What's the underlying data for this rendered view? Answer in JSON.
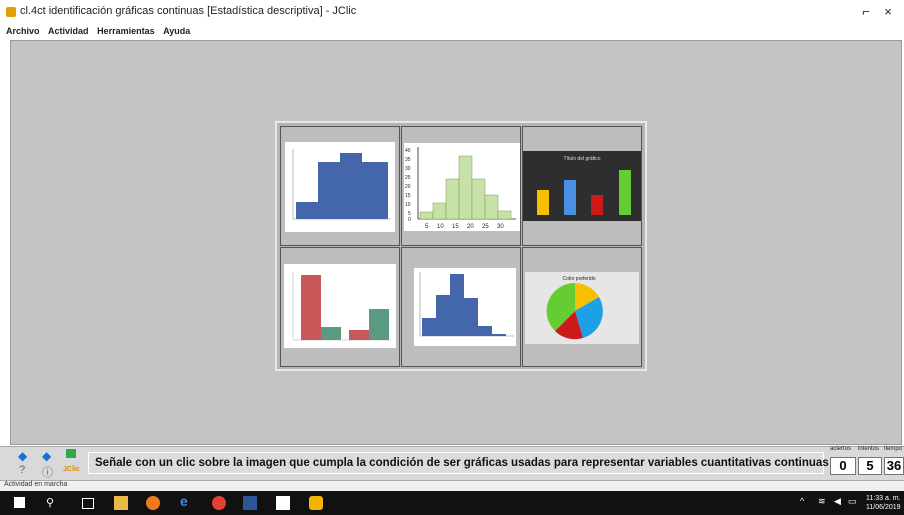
{
  "window": {
    "title": "cl.4ct identificación gráficas continuas [Estadística descriptiva] - JClic",
    "minimize_glyph": "⌐",
    "close_glyph": "×"
  },
  "menu": [
    "Archivo",
    "Actividad",
    "Herramientas",
    "Ayuda"
  ],
  "board": {
    "cells": [
      {
        "name": "histogram-blue",
        "kind": "image"
      },
      {
        "name": "histogram-green",
        "kind": "image"
      },
      {
        "name": "bar-chart-dark",
        "kind": "image"
      },
      {
        "name": "bar-chart-red-green",
        "kind": "image"
      },
      {
        "name": "histogram-blue-2",
        "kind": "image"
      },
      {
        "name": "pie-chart",
        "kind": "image"
      }
    ],
    "green_hist_yticks": [
      "40",
      "35",
      "30",
      "25",
      "20",
      "15",
      "10",
      "5",
      "0"
    ],
    "green_hist_xticks": [
      "5",
      "10",
      "15",
      "20",
      "25",
      "30"
    ],
    "dark_chart_title": "Título del gráfico",
    "pie_title": "Color preferido"
  },
  "controls": {
    "help_glyph": "?",
    "info_glyph": "ⓘ",
    "logo_text": "JClic"
  },
  "message": "Señale con un clic sobre la imagen que cumpla la  condición de ser gráficas usadas para representar variables cuantitativas continuas",
  "counters": {
    "labels": [
      "aciertos",
      "intentos",
      "tiempo"
    ],
    "values": [
      "0",
      "5",
      "36"
    ]
  },
  "status": "Actividad en marcha",
  "clock": {
    "time": "11:33 a. m.",
    "date": "11/06/2019"
  },
  "colors": {
    "workspace": "#c4c4c4",
    "hist_blue": "#4466aa",
    "hist_green": "#c7e2a8",
    "bar_yellow": "#f5c000",
    "bar_blue": "#4a90e2",
    "bar_red": "#cc1a1a",
    "bar_green": "#66cc33"
  }
}
